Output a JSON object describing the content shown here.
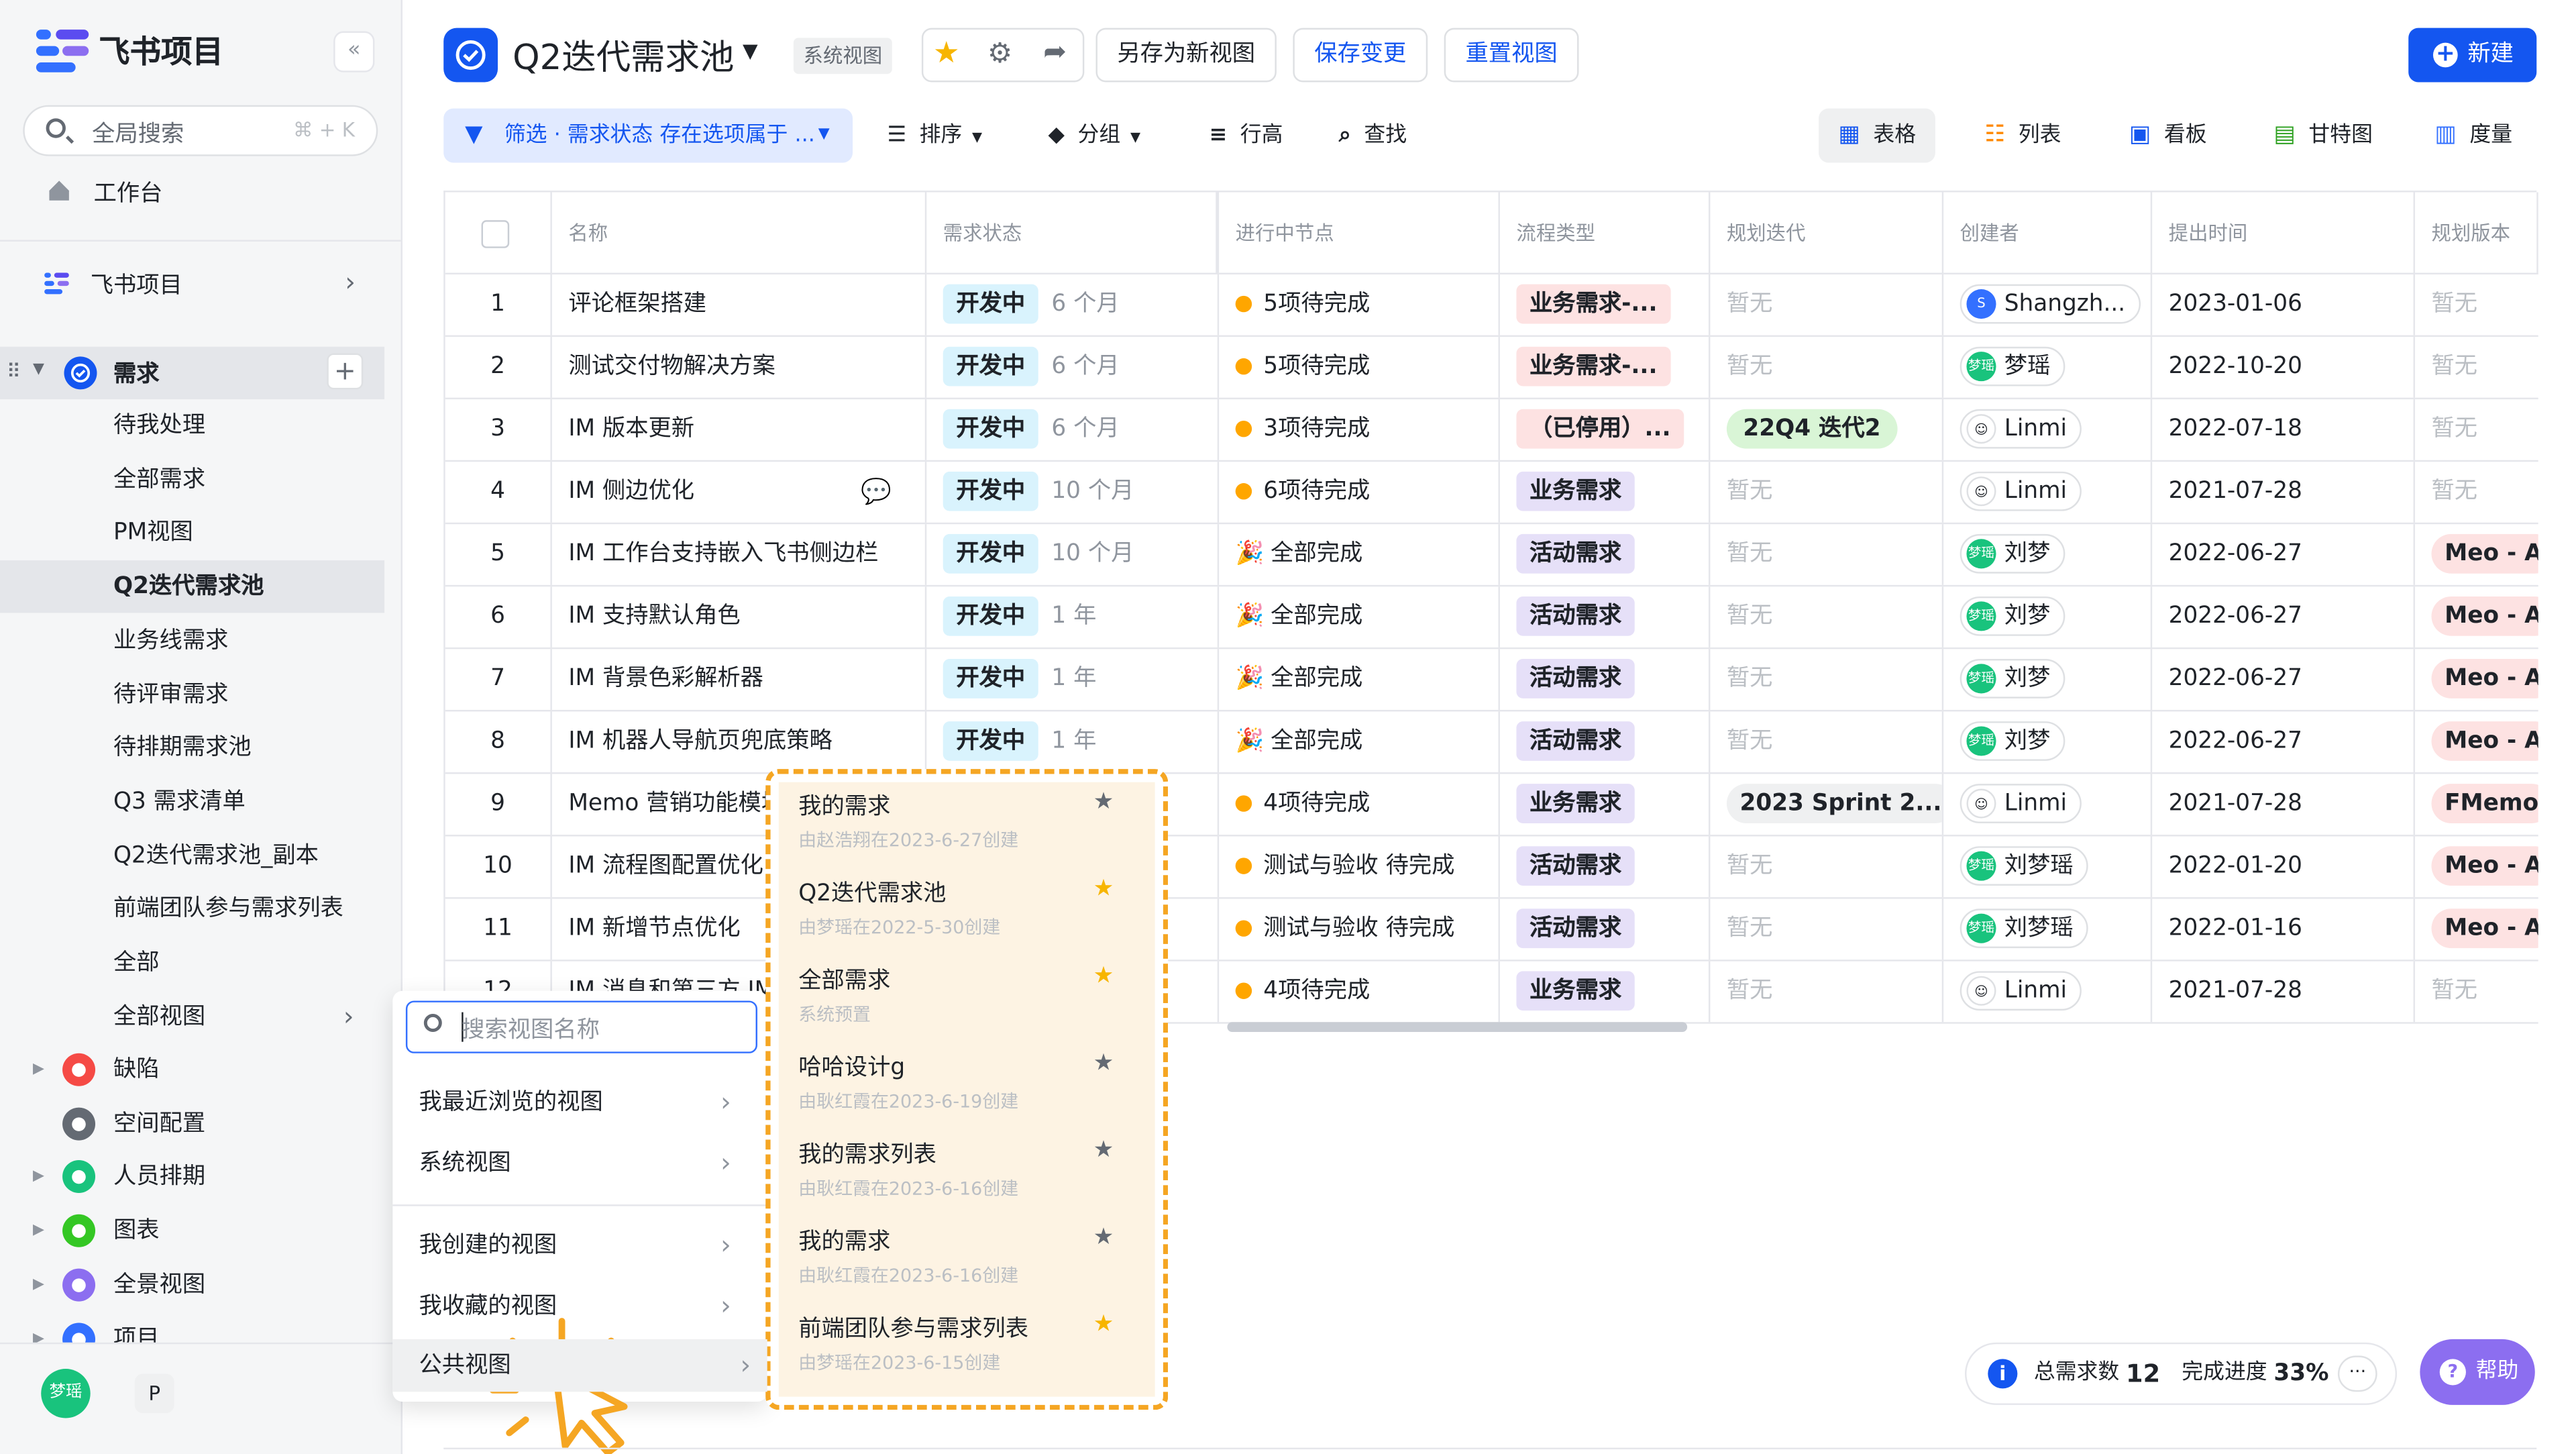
{
  "sidebar": {
    "brand": "飞书项目",
    "collapse_icon": "«",
    "search_placeholder": "全局搜索",
    "search_shortcut": "⌘ + K",
    "workbench": "工作台",
    "project_label": "飞书项目",
    "group": "需求",
    "views": [
      "待我处理",
      "全部需求",
      "PM视图",
      "Q2迭代需求池",
      "业务线需求",
      "待评审需求",
      "待排期需求池",
      "Q3 需求清单",
      "Q2迭代需求池_副本",
      "前端团队参与需求列表",
      "全部",
      "全部视图"
    ],
    "active_view": "Q2迭代需求池",
    "sections": [
      {
        "label": "缺陷",
        "color": "#f54a45"
      },
      {
        "label": "空间配置",
        "color": "#646a73"
      },
      {
        "label": "人员排期",
        "color": "#19c37d"
      },
      {
        "label": "图表",
        "color": "#34c724"
      },
      {
        "label": "全景视图",
        "color": "#8c6ef0"
      },
      {
        "label": "项目",
        "color": "#3370ff"
      }
    ],
    "user": "梦瑶",
    "user_short": "P"
  },
  "header": {
    "title": "Q2迭代需求池",
    "tag": "系统视图",
    "save_as": "另存为新视图",
    "save_changes": "保存变更",
    "reset": "重置视图",
    "new": "新建"
  },
  "toolbar": {
    "filter": "筛选 · 需求状态 存在选项属于 ...",
    "sort": "排序",
    "group": "分组",
    "row_height": "行高",
    "find": "查找",
    "view_tabs": [
      "表格",
      "列表",
      "看板",
      "甘特图",
      "度量"
    ],
    "active_tab": "表格"
  },
  "table": {
    "columns": [
      "名称",
      "需求状态",
      "进行中节点",
      "流程类型",
      "规划迭代",
      "创建者",
      "提出时间",
      "规划版本"
    ],
    "rows": [
      {
        "no": "1",
        "name": "评论框架搭建",
        "status": "开发中",
        "age": "6 个月",
        "node": "5项待完成",
        "type": "业务需求-...",
        "iter": "暂无",
        "creator": "Shangzh...",
        "date": "2023-01-06",
        "ver": "暂无"
      },
      {
        "no": "2",
        "name": "测试交付物解决方案",
        "status": "开发中",
        "age": "6 个月",
        "node": "5项待完成",
        "type": "业务需求-...",
        "iter": "暂无",
        "creator": "梦瑶",
        "date": "2022-10-20",
        "ver": "暂无"
      },
      {
        "no": "3",
        "name": "IM 版本更新",
        "status": "开发中",
        "age": "6 个月",
        "node": "3项待完成",
        "type": "（已停用）...",
        "iter": "22Q4 迭代2",
        "creator": "Linmi",
        "date": "2022-07-18",
        "ver": "暂无"
      },
      {
        "no": "4",
        "name": "IM 侧边优化",
        "status": "开发中",
        "age": "10 个月",
        "node": "6项待完成",
        "type": "业务需求",
        "iter": "暂无",
        "creator": "Linmi",
        "date": "2021-07-28",
        "ver": "暂无"
      },
      {
        "no": "5",
        "name": "IM 工作台支持嵌入飞书侧边栏",
        "status": "开发中",
        "age": "10 个月",
        "node": "全部完成",
        "type": "活动需求",
        "iter": "暂无",
        "creator": "刘梦",
        "date": "2022-06-27",
        "ver": "Meo - A"
      },
      {
        "no": "6",
        "name": "IM 支持默认角色",
        "status": "开发中",
        "age": "1 年",
        "node": "全部完成",
        "type": "活动需求",
        "iter": "暂无",
        "creator": "刘梦",
        "date": "2022-06-27",
        "ver": "Meo - A"
      },
      {
        "no": "7",
        "name": "IM 背景色彩解析器",
        "status": "开发中",
        "age": "1 年",
        "node": "全部完成",
        "type": "活动需求",
        "iter": "暂无",
        "creator": "刘梦",
        "date": "2022-06-27",
        "ver": "Meo - A"
      },
      {
        "no": "8",
        "name": "IM 机器人导航页兜底策略",
        "status": "开发中",
        "age": "1 年",
        "node": "全部完成",
        "type": "活动需求",
        "iter": "暂无",
        "creator": "刘梦",
        "date": "2022-06-27",
        "ver": "Meo - A"
      },
      {
        "no": "9",
        "name": "Memo 营销功能模块",
        "status": "",
        "age": "",
        "node": "4项待完成",
        "type": "业务需求",
        "iter": "2023 Sprint 2...",
        "creator": "Linmi",
        "date": "2021-07-28",
        "ver": "FMemo"
      },
      {
        "no": "10",
        "name": "IM 流程图配置优化",
        "status": "",
        "age": "",
        "node": "测试与验收 待完成",
        "type": "活动需求",
        "iter": "暂无",
        "creator": "刘梦瑶",
        "date": "2022-01-20",
        "ver": "Meo - A"
      },
      {
        "no": "11",
        "name": "IM 新增节点优化",
        "status": "",
        "age": "",
        "node": "测试与验收 待完成",
        "type": "活动需求",
        "iter": "暂无",
        "creator": "刘梦瑶",
        "date": "2022-01-16",
        "ver": "Meo - A"
      },
      {
        "no": "12",
        "name": "IM 消息和第三方 IM",
        "status": "",
        "age": "",
        "node": "4项待完成",
        "type": "业务需求",
        "iter": "暂无",
        "creator": "Linmi",
        "date": "2021-07-28",
        "ver": "暂无"
      }
    ]
  },
  "popup": {
    "search_placeholder": "搜索视图名称",
    "menu": [
      "我最近浏览的视图",
      "系统视图",
      "我创建的视图",
      "我收藏的视图",
      "公共视图"
    ],
    "active_menu": "公共视图",
    "views": [
      {
        "name": "我的需求",
        "sub": "由赵浩翔在2023-6-27创建",
        "starred": false
      },
      {
        "name": "Q2迭代需求池",
        "sub": "由梦瑶在2022-5-30创建",
        "starred": true
      },
      {
        "name": "全部需求",
        "sub": "系统预置",
        "starred": true
      },
      {
        "name": "哈哈设计g",
        "sub": "由耿红霞在2023-6-19创建",
        "starred": false
      },
      {
        "name": "我的需求列表",
        "sub": "由耿红霞在2023-6-16创建",
        "starred": false
      },
      {
        "name": "我的需求",
        "sub": "由耿红霞在2023-6-16创建",
        "starred": false
      },
      {
        "name": "前端团队参与需求列表",
        "sub": "由梦瑶在2023-6-15创建",
        "starred": true
      }
    ]
  },
  "stats": {
    "total_label": "总需求数",
    "total": "12",
    "progress_label": "完成进度",
    "progress": "33%",
    "more": "···",
    "help": "帮助"
  }
}
